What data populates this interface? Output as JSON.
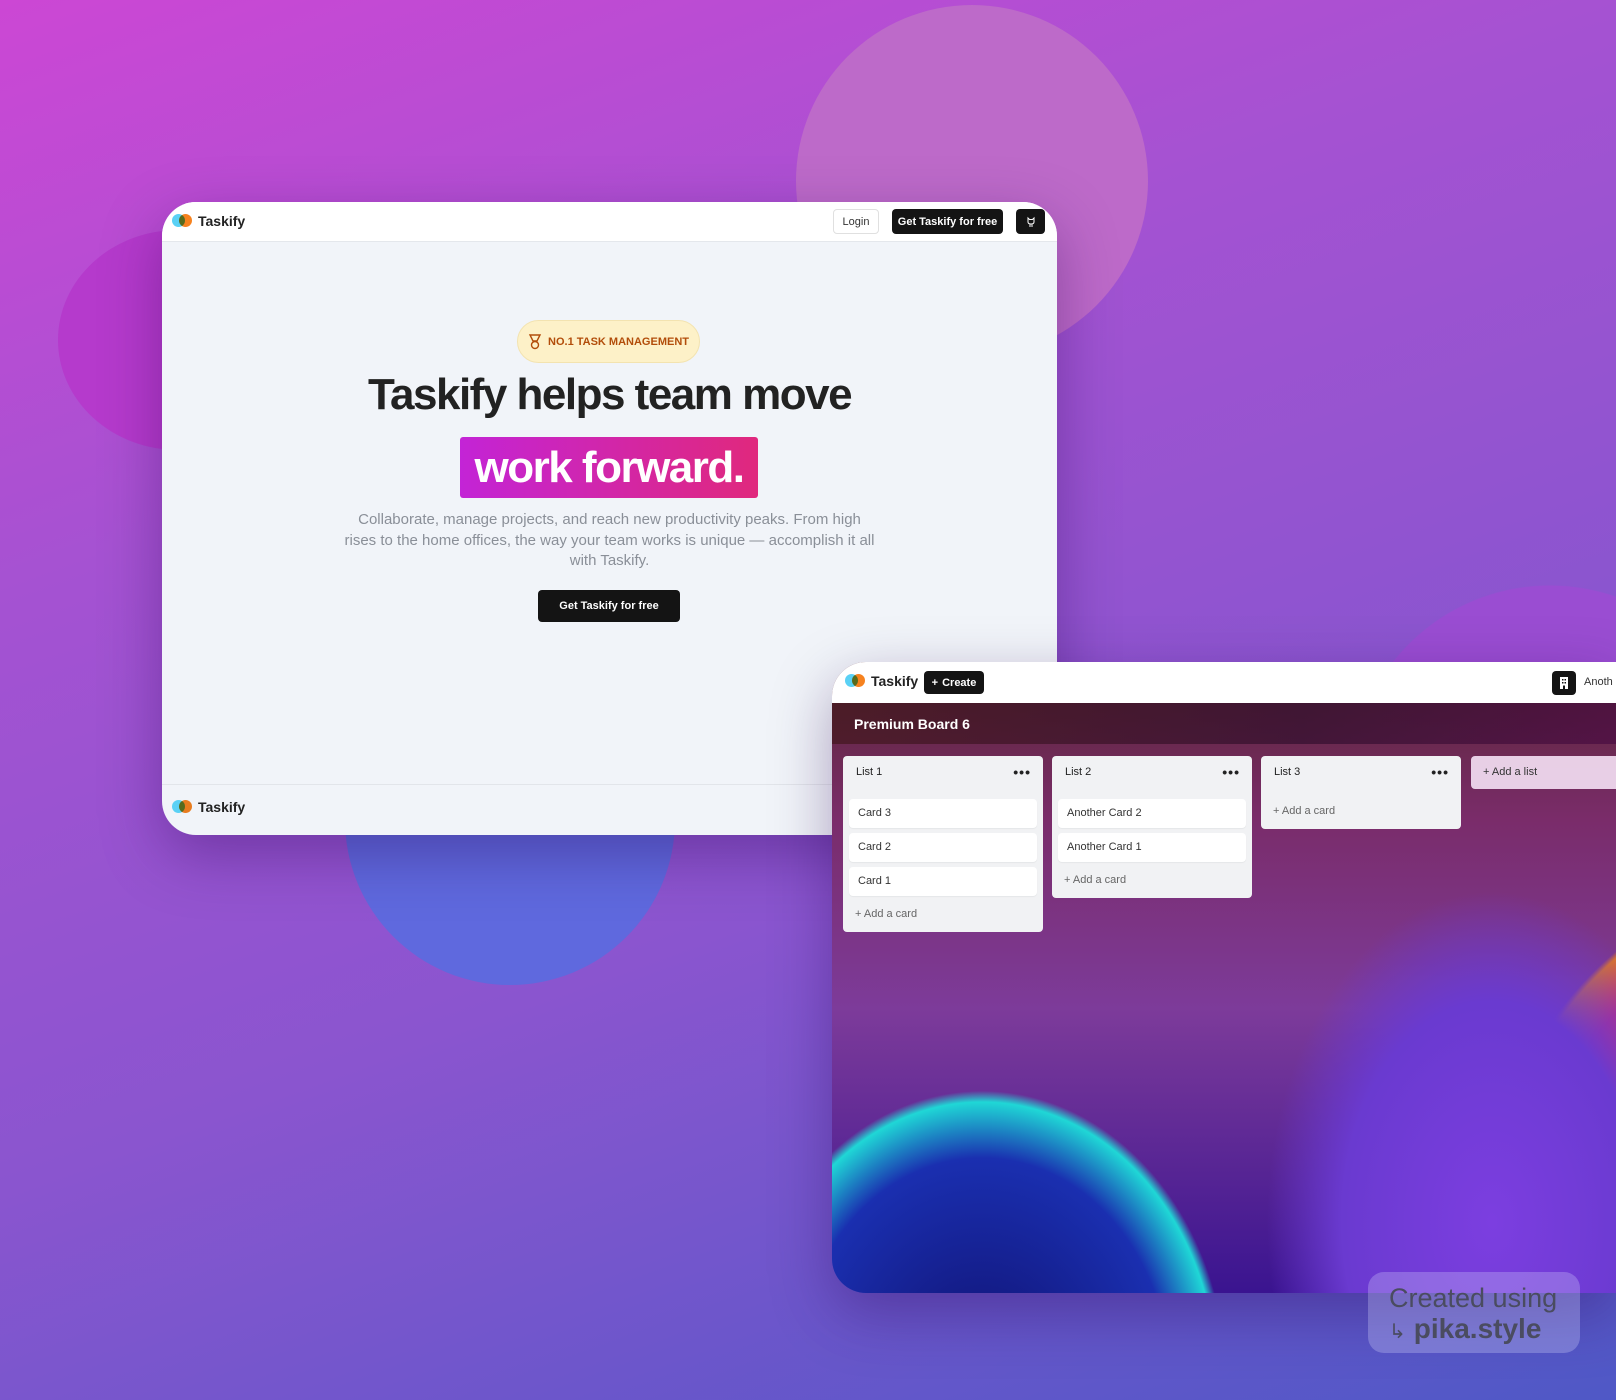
{
  "landing": {
    "brand": "Taskify",
    "nav": {
      "login": "Login",
      "cta": "Get Taskify for free",
      "github_icon": "github-icon"
    },
    "badge": {
      "icon": "medal-icon",
      "text": "NO.1 TASK MANAGEMENT"
    },
    "headline": "Taskify helps team move",
    "highlight": "work forward.",
    "description": "Collaborate, manage projects, and reach new productivity peaks. From high rises to the home offices, the way your team works is unique — accomplish it all with Taskify.",
    "cta": "Get Taskify for free",
    "footer_brand": "Taskify",
    "highlight_colors": [
      "#c324d6",
      "#e0287d"
    ]
  },
  "board_app": {
    "brand": "Taskify",
    "create": "Create",
    "org_icon": "building-icon",
    "org_name": "Anoth",
    "board_title": "Premium Board 6",
    "lists": [
      {
        "title": "List 1",
        "cards": [
          "Card 3",
          "Card 2",
          "Card 1"
        ],
        "add": "Add a card"
      },
      {
        "title": "List 2",
        "cards": [
          "Another Card 2",
          "Another Card 1"
        ],
        "add": "Add a card"
      },
      {
        "title": "List 3",
        "cards": [],
        "add": "Add a card"
      }
    ],
    "add_list": "Add a list"
  },
  "watermark": {
    "line1": "Created using",
    "line2": "pika.style"
  }
}
